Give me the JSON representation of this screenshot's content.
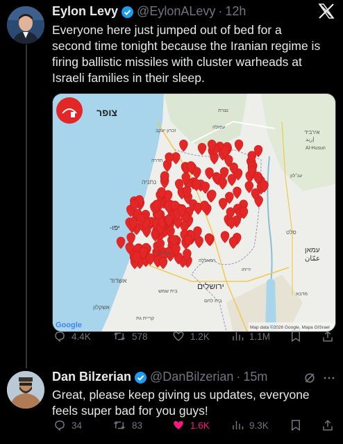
{
  "tweet1": {
    "author_name": "Eylon Levy",
    "handle": "@EylonALevy",
    "separator": "·",
    "time": "12h",
    "text_lines": [
      "Everyone here just jumped out of bed for a",
      "second time tonight because the Iranian regime is",
      "firing ballistic missiles with cluster warheads at",
      "Israeli families in their sleep."
    ],
    "media": {
      "logo_text": "צופר",
      "google_label": "Google",
      "attribution": "Map data ©2026 Google, Mapa GISrael",
      "places": {
        "netanya": "נתניה",
        "tel_aviv": "-יפו",
        "ashdod": "אשדוד",
        "ashkelon": "אשקלון",
        "jerusalem": "ירושלים",
        "amman_he": "עמאן",
        "amman_ar": "عمّان",
        "irbid_he": "אירביד",
        "irbid_ar": "إربد",
        "alhusun": "Al-Husun",
        "ajloun": "עג׳לון",
        "salt": "סלט",
        "jericho": "יריחו",
        "modiin": "מודיעין",
        "ramallah": "רמאללה",
        "beit_shemesh": "בית שמש",
        "madaba": "מדבא",
        "beit_lehem": "בית לחם",
        "kiryat_gat": "קריית גת",
        "hadera": "חדרה",
        "zikhron": "זכרון יעקב",
        "afula": "עפולה",
        "nazareth": "נצרת"
      },
      "alert_color": "#e32626",
      "sea_color": "#a8d4ec",
      "land_color": "#eeeeea"
    },
    "actions": {
      "replies": "4.4K",
      "reposts": "578",
      "likes": "1.2K",
      "views": "1.1M"
    }
  },
  "tweet2": {
    "author_name": "Dan Bilzerian",
    "handle": "@DanBilzerian",
    "separator": "·",
    "time": "15m",
    "text_lines": [
      "Great, please keep giving us updates, everyone",
      "feels super bad for you guys!"
    ],
    "actions": {
      "replies": "34",
      "reposts": "83",
      "likes": "1.6K",
      "views": "9.3K"
    },
    "like_color": "#f91880"
  },
  "icons": [
    "verified-badge-icon",
    "x-logo-icon",
    "reply-icon",
    "repost-icon",
    "like-icon",
    "views-icon",
    "bookmark-icon",
    "share-icon",
    "grok-icon",
    "more-icon"
  ],
  "colors": {
    "background": "#000000",
    "text": "#e7e9ea",
    "muted": "#71767b",
    "verified": "#1d9bf0"
  }
}
